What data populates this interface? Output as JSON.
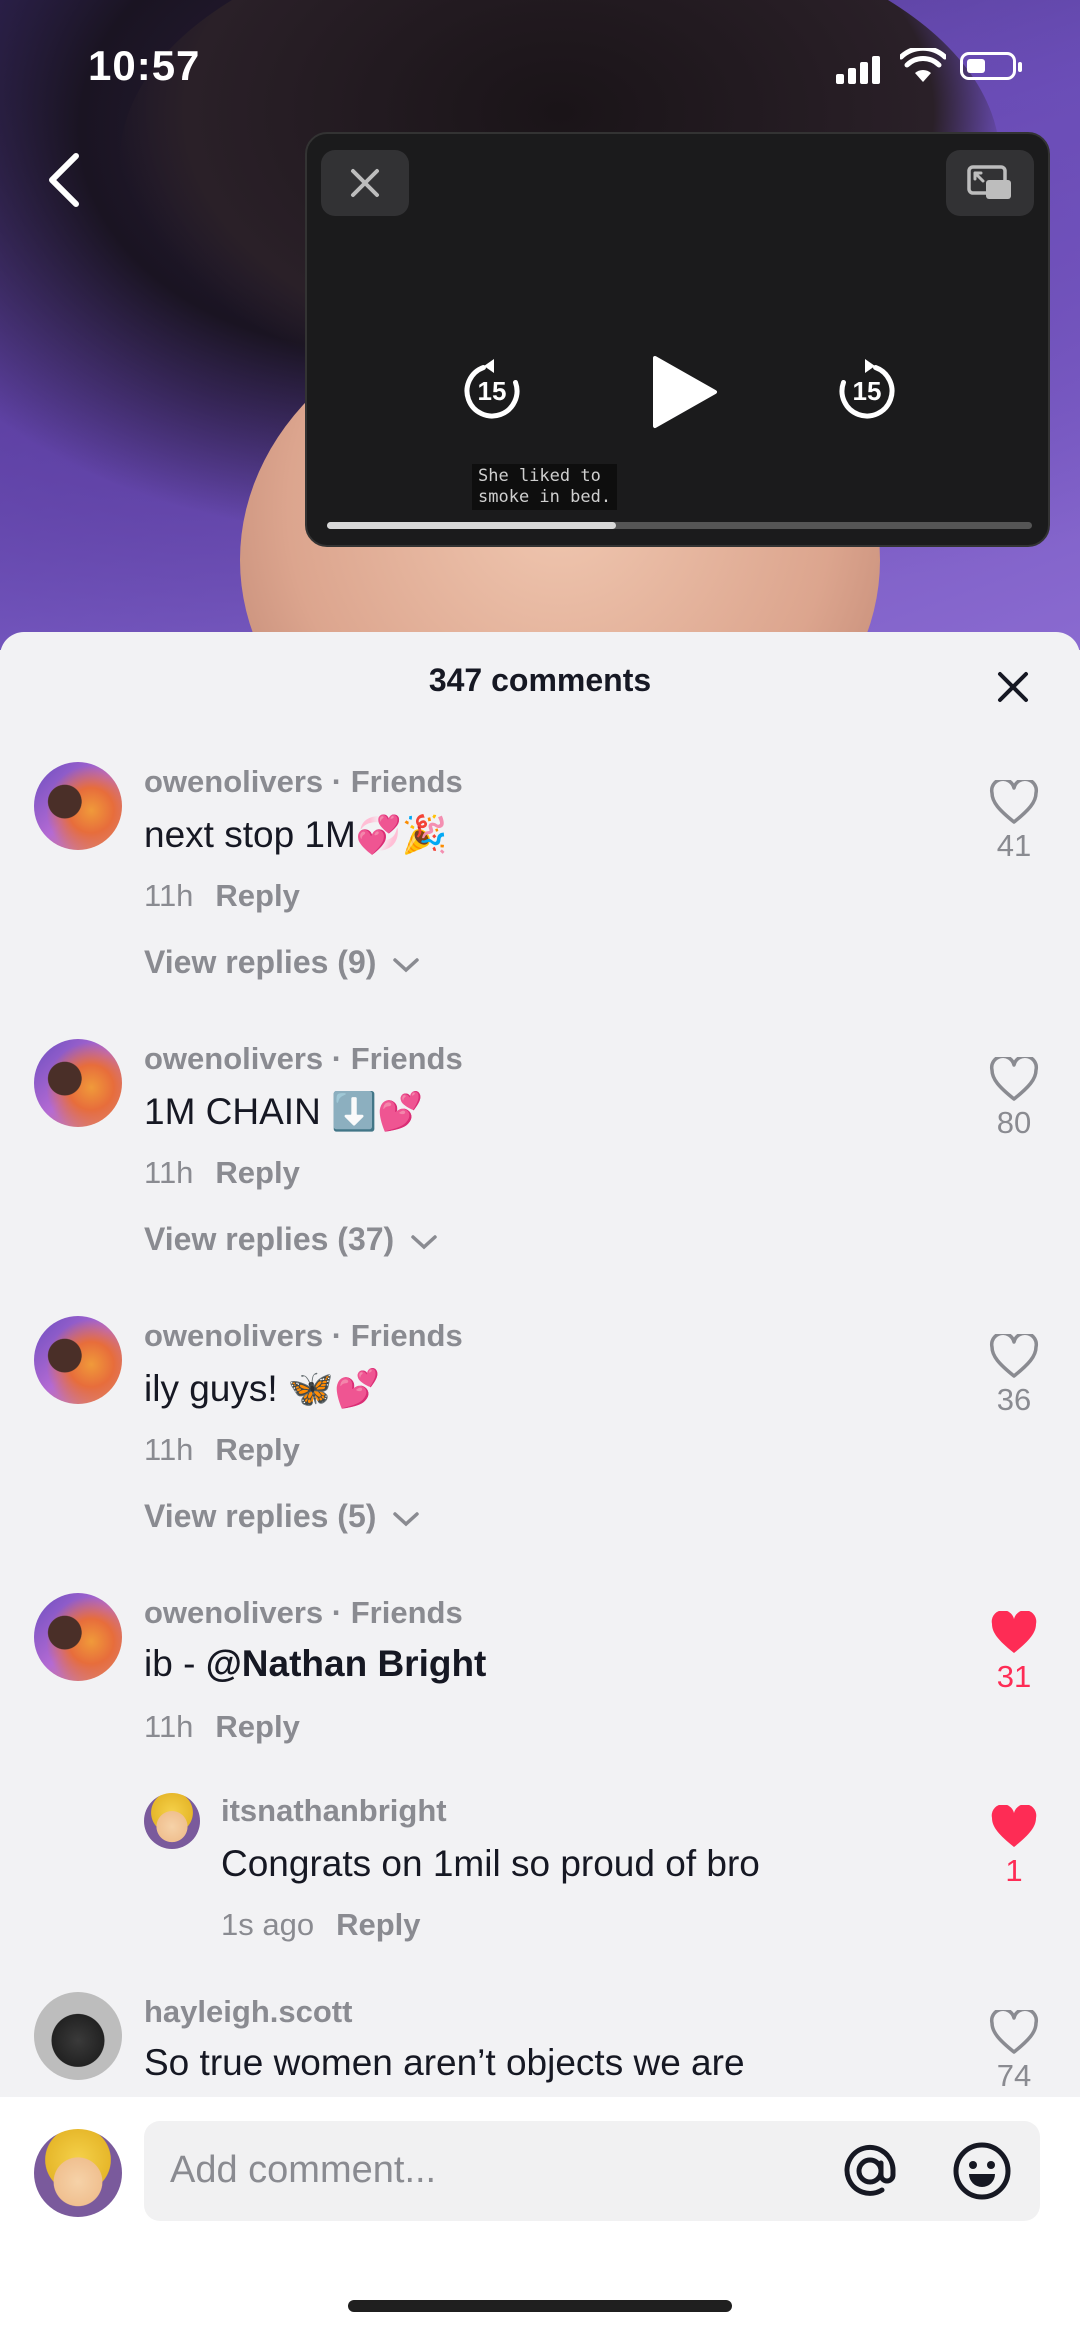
{
  "status_bar": {
    "time": "10:57"
  },
  "video": {
    "pip_caption": "She liked to\nsmoke in bed.",
    "progress": 0.41,
    "rewind_seconds": "15",
    "forward_seconds": "15"
  },
  "sheet": {
    "title": "347 comments",
    "comments": [
      {
        "username": "owenolivers",
        "tag": " · Friends",
        "text": "next stop 1M💞🎉",
        "time": "11h",
        "reply_label": "Reply",
        "likes": "41",
        "liked": false,
        "view_replies": "View replies (9)"
      },
      {
        "username": "owenolivers",
        "tag": " · Friends",
        "text": "1M CHAIN ⬇️💕",
        "time": "11h",
        "reply_label": "Reply",
        "likes": "80",
        "liked": false,
        "view_replies": "View replies (37)"
      },
      {
        "username": "owenolivers",
        "tag": " · Friends",
        "text": "ily guys! 🦋💕",
        "time": "11h",
        "reply_label": "Reply",
        "likes": "36",
        "liked": false,
        "view_replies": "View replies (5)"
      },
      {
        "username": "owenolivers",
        "tag": " · Friends",
        "text_prefix": "ib - ",
        "mention": "@Nathan Bright",
        "time": "11h",
        "reply_label": "Reply",
        "likes": "31",
        "liked": true
      },
      {
        "username": "itsnathanbright",
        "text": "Congrats on 1mil so proud of bro",
        "time": "1s ago",
        "reply_label": "Reply",
        "likes": "1",
        "liked": true
      },
      {
        "username": "hayleigh.scott",
        "text": "So true women aren’t objects we are",
        "likes": "74",
        "liked": false
      }
    ]
  },
  "composer": {
    "placeholder": "Add comment..."
  },
  "colors": {
    "like_red": "#fe2c55",
    "muted_text": "#8a8b91",
    "primary_text": "#161823"
  }
}
